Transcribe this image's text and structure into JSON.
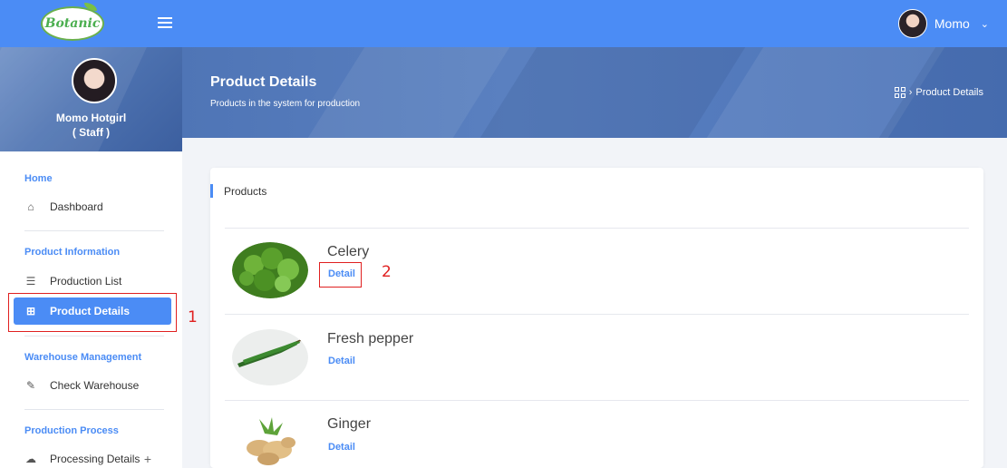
{
  "app": {
    "logo_text": "Botanic"
  },
  "topbar": {
    "username": "Momo",
    "caret": "⌄"
  },
  "profile": {
    "name": "Momo Hotgirl",
    "role": "( Staff )"
  },
  "sidebar": {
    "sections": [
      {
        "title": "Home",
        "items": [
          {
            "label": "Dashboard",
            "icon": "home-icon"
          }
        ]
      },
      {
        "title": "Product Information",
        "items": [
          {
            "label": "Production List",
            "icon": "list-icon"
          },
          {
            "label": "Product Details",
            "icon": "grid-icon",
            "active": true
          }
        ]
      },
      {
        "title": "Warehouse Management",
        "items": [
          {
            "label": "Check Warehouse",
            "icon": "edit-icon"
          }
        ]
      },
      {
        "title": "Production Process",
        "items": [
          {
            "label": "Processing Details",
            "icon": "cloud-icon",
            "expand": "+"
          }
        ]
      }
    ]
  },
  "header": {
    "title": "Product Details",
    "subtitle": "Products in the system for production",
    "breadcrumb_sep": "›",
    "breadcrumb": "Product Details"
  },
  "products": {
    "title": "Products",
    "items": [
      {
        "name": "Celery",
        "link": "Detail",
        "image": "celery-image"
      },
      {
        "name": "Fresh pepper",
        "link": "Detail",
        "image": "pepper-image"
      },
      {
        "name": "Ginger",
        "link": "Detail",
        "image": "ginger-image"
      }
    ]
  },
  "annotations": {
    "box1": "1",
    "box2": "2"
  },
  "colors": {
    "accent": "#4b8cf5",
    "annotation": "#e02020",
    "banner": "#4f75b6"
  }
}
